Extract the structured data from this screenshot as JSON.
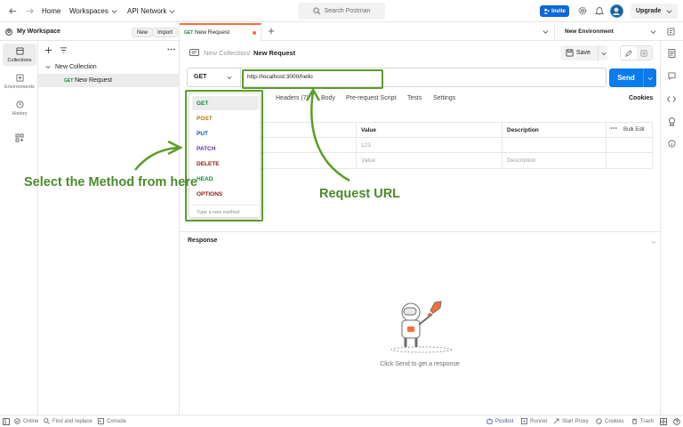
{
  "topbar": {
    "home": "Home",
    "workspaces": "Workspaces",
    "api_network": "API Network",
    "search_placeholder": "Search Postman",
    "invite": "Invite",
    "upgrade": "Upgrade"
  },
  "sidebar": {
    "workspace_name": "My Workspace",
    "new_button": "New",
    "import_button": "Import",
    "rail": [
      {
        "label": "Collections",
        "icon": "collections-icon"
      },
      {
        "label": "Environments",
        "icon": "environments-icon"
      },
      {
        "label": "History",
        "icon": "history-icon"
      }
    ],
    "collection_name": "New Collection",
    "request_method": "GET",
    "request_name": "New Request"
  },
  "tabs": {
    "active_method": "GET",
    "active_name": "New Request",
    "environment": "New Environment"
  },
  "request": {
    "breadcrumb_collection": "New Collection",
    "breadcrumb_separator": "/",
    "breadcrumb_request": "New Request",
    "save_label": "Save",
    "method": "GET",
    "url": "http://localhost:3000/hello",
    "send_label": "Send",
    "subtabs": [
      "Headers (7)",
      "Body",
      "Pre-request Script",
      "Tests",
      "Settings"
    ],
    "cookies_label": "Cookies",
    "table_headers": {
      "value": "Value",
      "description": "Description",
      "bulk_edit": "Bulk Edit"
    },
    "rows": [
      {
        "value": "123",
        "description": ""
      },
      {
        "value": "Value",
        "description": "Description"
      }
    ]
  },
  "method_dropdown": {
    "options": [
      {
        "label": "GET",
        "color": "#0b8a3e"
      },
      {
        "label": "POST",
        "color": "#ad7a03"
      },
      {
        "label": "PUT",
        "color": "#0053b8"
      },
      {
        "label": "PATCH",
        "color": "#623497"
      },
      {
        "label": "DELETE",
        "color": "#8e1a10"
      },
      {
        "label": "HEAD",
        "color": "#0b8a3e"
      },
      {
        "label": "OPTIONS",
        "color": "#8e1a10"
      }
    ],
    "new_method_placeholder": "Type a new method"
  },
  "annotations": {
    "select_method": "Select the Method from here",
    "request_url": "Request URL"
  },
  "response": {
    "title": "Response",
    "empty_text": "Click Send to get a response"
  },
  "statusbar": {
    "online": "Online",
    "find_replace": "Find and replace",
    "console": "Console",
    "postbot": "Postbot",
    "runner": "Runner",
    "start_proxy": "Start Proxy",
    "cookies": "Cookies",
    "trash": "Trash"
  },
  "colors": {
    "accent_orange": "#ff6c37",
    "send_blue": "#097bed",
    "invite_blue": "#0c68d9",
    "annotation_green": "#5b9c2a"
  }
}
